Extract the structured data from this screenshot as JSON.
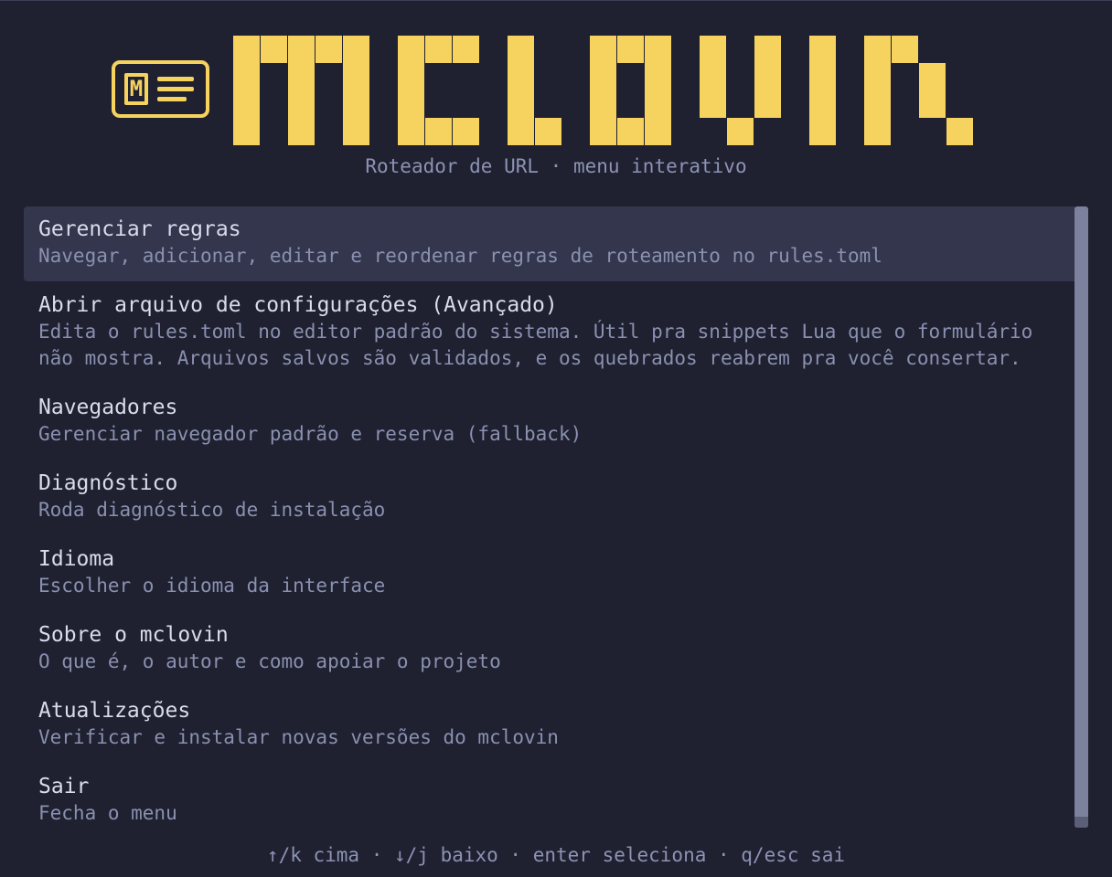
{
  "app": {
    "title": "mclovin",
    "logo_letter": "M",
    "subtitle": "Roteador de URL · menu interativo"
  },
  "colors": {
    "background": "#1f2030",
    "accent": "#f6d35f",
    "selected_bg": "#33364c",
    "title_text": "#d8dcec",
    "desc_text": "#8a91b0"
  },
  "menu": {
    "selected_index": 0,
    "items": [
      {
        "title": "Gerenciar regras",
        "desc": [
          "Navegar, adicionar, editar e reordenar regras de roteamento no rules.toml"
        ]
      },
      {
        "title": "Abrir arquivo de configurações (Avançado)",
        "desc": [
          "Edita o rules.toml no editor padrão do sistema. Útil pra snippets Lua que o formulário",
          "não mostra. Arquivos salvos são validados, e os quebrados reabrem pra você consertar."
        ]
      },
      {
        "title": "Navegadores",
        "desc": [
          "Gerenciar navegador padrão e reserva (fallback)"
        ]
      },
      {
        "title": "Diagnóstico",
        "desc": [
          "Roda diagnóstico de instalação"
        ]
      },
      {
        "title": "Idioma",
        "desc": [
          "Escolher o idioma da interface"
        ]
      },
      {
        "title": "Sobre o mclovin",
        "desc": [
          "O que é, o autor e como apoiar o projeto"
        ]
      },
      {
        "title": "Atualizações",
        "desc": [
          "Verificar e instalar novas versões do mclovin"
        ]
      },
      {
        "title": "Sair",
        "desc": [
          "Fecha o menu"
        ]
      }
    ]
  },
  "footer": {
    "hint": "↑/k cima · ↓/j baixo · enter seleciona · q/esc sai"
  }
}
